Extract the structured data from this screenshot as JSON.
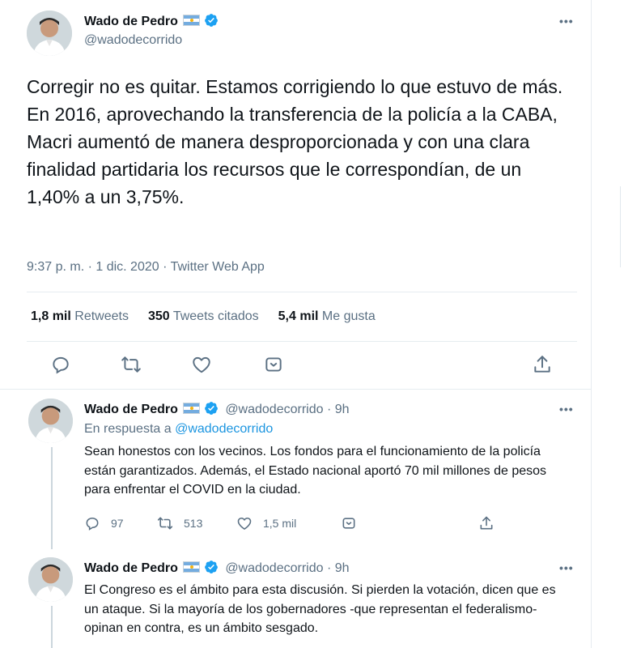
{
  "main_tweet": {
    "author_name": "Wado de Pedro",
    "author_handle": "@wadodecorrido",
    "text": "Corregir no es quitar. Estamos corrigiendo lo que estuvo de más. En 2016, aprovechando la transferencia de la policía a la CABA, Macri aumentó de manera desproporcionada y con una clara finalidad partidaria los recursos que le correspondían, de un 1,40% a un 3,75%.",
    "meta": "9:37 p. m. · 1 dic. 2020 · Twitter Web App",
    "stats": {
      "retweets_count": "1,8 mil",
      "retweets_label": "Retweets",
      "quotes_count": "350",
      "quotes_label": "Tweets citados",
      "likes_count": "5,4 mil",
      "likes_label": "Me gusta"
    },
    "more_label": "•••"
  },
  "replies": [
    {
      "author_name": "Wado de Pedro",
      "author_handle": "@wadodecorrido",
      "time": "· 9h",
      "reply_prefix": "En respuesta a",
      "reply_handle": "@wadodecorrido",
      "text": "Sean honestos con los vecinos. Los fondos para el funcionamiento de la policía están garantizados. Además, el Estado nacional aportó 70 mil millones de pesos para enfrentar el COVID en la ciudad.",
      "counts": {
        "replies": "97",
        "retweets": "513",
        "likes": "1,5 mil"
      },
      "more_label": "•••"
    },
    {
      "author_name": "Wado de Pedro",
      "author_handle": "@wadodecorrido",
      "time": "· 9h",
      "text": "El Congreso es el ámbito para esta discusión. Si pierden la votación, dicen que es un ataque. Si la mayoría de los gobernadores -que representan el federalismo- opinan en contra, es un ámbito sesgado.",
      "more_label": "•••"
    }
  ],
  "icons": [
    "verified-badge-icon",
    "argentina-flag-icon",
    "reply-icon",
    "retweet-icon",
    "like-icon",
    "bookmark-icon",
    "share-icon",
    "more-icon"
  ],
  "colors": {
    "accent": "#1da1f2",
    "link": "#1b95e0",
    "secondary_text": "#5b7083",
    "border": "#e6ecf0"
  }
}
